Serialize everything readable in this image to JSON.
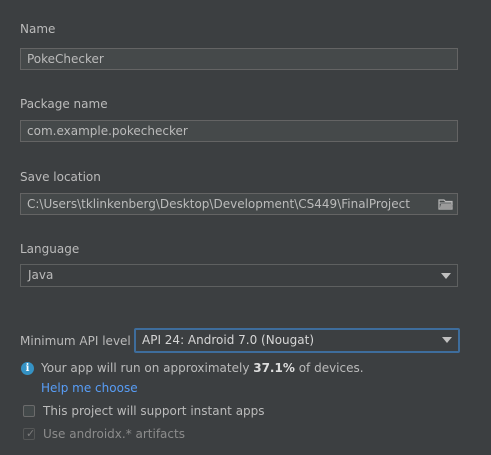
{
  "form": {
    "name": {
      "label": "Name",
      "value": "PokeChecker"
    },
    "package_name": {
      "label": "Package name",
      "value": "com.example.pokechecker"
    },
    "save_location": {
      "label": "Save location",
      "value": "C:\\Users\\tklinkenberg\\Desktop\\Development\\CS449\\FinalProject",
      "browse_icon": "folder-icon"
    },
    "language": {
      "label": "Language",
      "selected": "Java"
    },
    "min_api": {
      "label": "Minimum API level",
      "selected": "API 24: Android 7.0 (Nougat)"
    },
    "info": {
      "icon": "info-icon",
      "text_before": "Your app will run on approximately ",
      "percent": "37.1%",
      "text_after": " of devices.",
      "help_link": "Help me choose"
    },
    "instant_apps": {
      "label": "This project will support instant apps",
      "checked": false,
      "enabled": true
    },
    "androidx": {
      "label": "Use androidx.* artifacts",
      "checked": true,
      "enabled": false
    }
  },
  "colors": {
    "background": "#3c3f41",
    "link": "#589df6",
    "focus_border": "#3e6d9c",
    "info_icon": "#3592c4"
  }
}
